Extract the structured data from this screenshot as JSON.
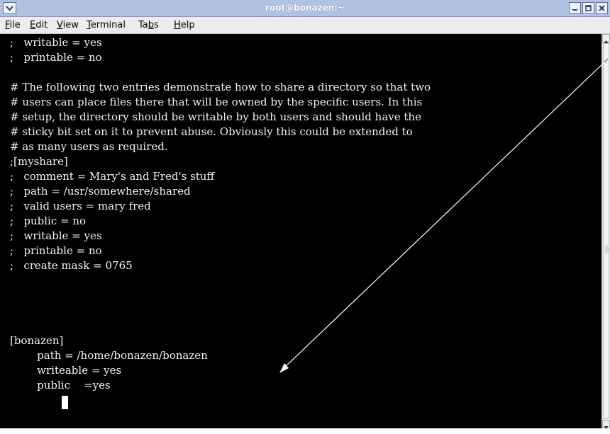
{
  "window": {
    "title": "root@bonazen:~"
  },
  "menu": {
    "items": [
      {
        "pre": "",
        "u": "F",
        "post": "ile"
      },
      {
        "pre": "",
        "u": "E",
        "post": "dit"
      },
      {
        "pre": "",
        "u": "V",
        "post": "iew"
      },
      {
        "pre": "",
        "u": "T",
        "post": "erminal"
      },
      {
        "pre": "Ta",
        "u": "b",
        "post": "s"
      },
      {
        "pre": "",
        "u": "H",
        "post": "elp"
      }
    ]
  },
  "terminal": {
    "lines": [
      ";   writable = yes",
      ";   printable = no",
      "",
      "# The following two entries demonstrate how to share a directory so that two",
      "# users can place files there that will be owned by the specific users. In this",
      "# setup, the directory should be writable by both users and should have the",
      "# sticky bit set on it to prevent abuse. Obviously this could be extended to",
      "# as many users as required.",
      ";[myshare]",
      ";   comment = Mary's and Fred's stuff",
      ";   path = /usr/somewhere/shared",
      ";   valid users = mary fred",
      ";   public = no",
      ";   writable = yes",
      ";   printable = no",
      ";   create mask = 0765",
      "",
      "",
      "",
      "[bonazen]",
      "        path = /home/bonazen/bonazen",
      "        writeable = yes",
      "        public    =yes"
    ]
  },
  "colors": {
    "terminal_bg": "#000000",
    "terminal_fg": "#f2f2f2",
    "titlebar": "#b3c4e3",
    "annotation": "#ffffff"
  }
}
